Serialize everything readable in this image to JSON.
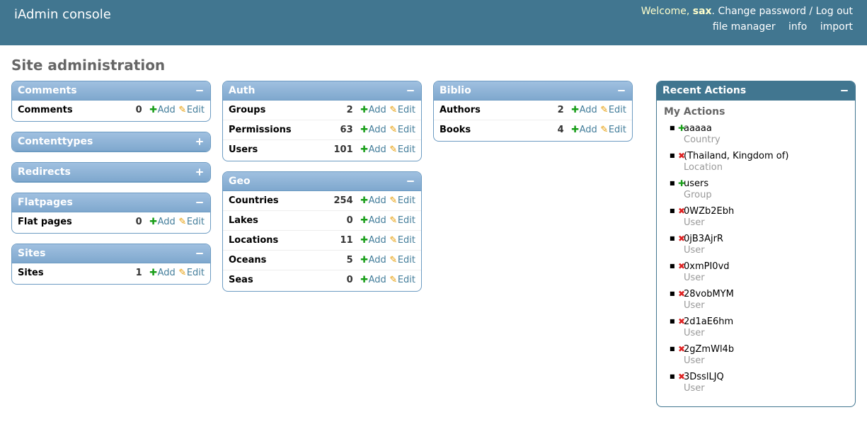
{
  "header": {
    "site_name": "iAdmin console",
    "welcome_prefix": "Welcome, ",
    "username": "sax",
    "welcome_suffix": ". ",
    "change_password": "Change password",
    "sep": " / ",
    "logout": "Log out",
    "nav": {
      "file_manager": "file manager",
      "info": "info",
      "import": "import"
    }
  },
  "page_title": "Site administration",
  "add_label": "Add",
  "edit_label": "Edit",
  "columns": [
    [
      {
        "title": "Comments",
        "collapsed": false,
        "rows": [
          {
            "name": "Comments",
            "count": 0
          }
        ]
      },
      {
        "title": "Contenttypes",
        "collapsed": true,
        "rows": []
      },
      {
        "title": "Redirects",
        "collapsed": true,
        "rows": []
      },
      {
        "title": "Flatpages",
        "collapsed": false,
        "rows": [
          {
            "name": "Flat pages",
            "count": 0
          }
        ]
      },
      {
        "title": "Sites",
        "collapsed": false,
        "rows": [
          {
            "name": "Sites",
            "count": 1
          }
        ]
      }
    ],
    [
      {
        "title": "Auth",
        "collapsed": false,
        "rows": [
          {
            "name": "Groups",
            "count": 2
          },
          {
            "name": "Permissions",
            "count": 63
          },
          {
            "name": "Users",
            "count": 101
          }
        ]
      },
      {
        "title": "Geo",
        "collapsed": false,
        "rows": [
          {
            "name": "Countries",
            "count": 254
          },
          {
            "name": "Lakes",
            "count": 0
          },
          {
            "name": "Locations",
            "count": 11
          },
          {
            "name": "Oceans",
            "count": 5
          },
          {
            "name": "Seas",
            "count": 0
          }
        ]
      }
    ],
    [
      {
        "title": "Biblio",
        "collapsed": false,
        "rows": [
          {
            "name": "Authors",
            "count": 2
          },
          {
            "name": "Books",
            "count": 4
          }
        ]
      }
    ]
  ],
  "recent": {
    "title": "Recent Actions",
    "subtitle": "My Actions",
    "items": [
      {
        "action": "add",
        "name": "aaaaa",
        "type": "Country"
      },
      {
        "action": "del",
        "name": "(Thailand, Kingdom of)",
        "type": "Location"
      },
      {
        "action": "add",
        "name": "users",
        "type": "Group"
      },
      {
        "action": "del",
        "name": "0WZb2Ebh",
        "type": "User"
      },
      {
        "action": "del",
        "name": "0jB3AjrR",
        "type": "User"
      },
      {
        "action": "del",
        "name": "0xmPI0vd",
        "type": "User"
      },
      {
        "action": "del",
        "name": "28vobMYM",
        "type": "User"
      },
      {
        "action": "del",
        "name": "2d1aE6hm",
        "type": "User"
      },
      {
        "action": "del",
        "name": "2gZmWl4b",
        "type": "User"
      },
      {
        "action": "del",
        "name": "3DsslLJQ",
        "type": "User"
      }
    ]
  }
}
